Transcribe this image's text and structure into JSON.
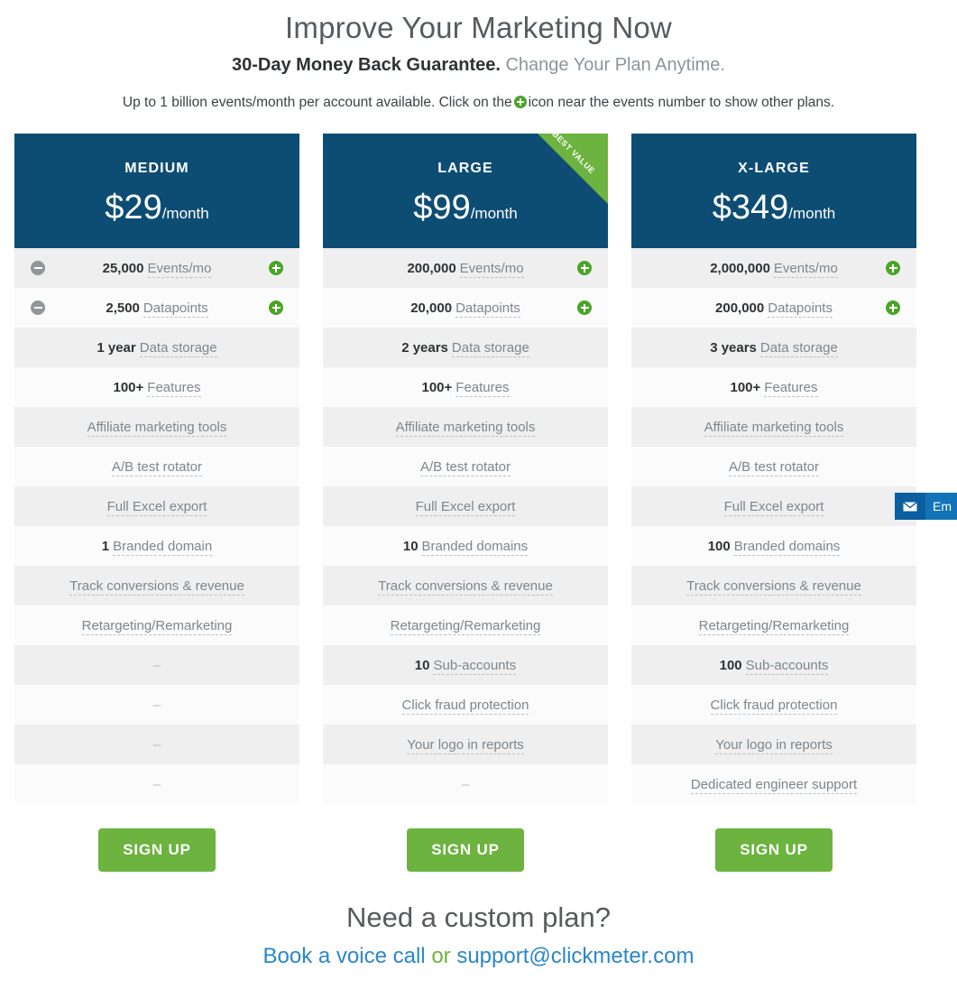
{
  "hero": {
    "title": "Improve Your Marketing Now",
    "subtitle_strong": "30-Day Money Back Guarantee.",
    "subtitle_muted": "Change Your Plan Anytime.",
    "note_before": "Up to 1 billion events/month per account available. Click on the",
    "note_after": "icon near the events number to show other plans.",
    "plus_icon": "plus-circle-icon"
  },
  "colors": {
    "header_navy": "#0d4d74",
    "accent_green": "#6cb33f",
    "icon_green": "#4aa527",
    "icon_gray": "#8f9799",
    "link_blue": "#2a87c8",
    "row_odd": "#efefef",
    "row_even": "#fbfbfb"
  },
  "plans": [
    {
      "name": "MEDIUM",
      "price": "$29",
      "per": "/month",
      "badge": null,
      "signup_label": "SIGN UP",
      "rows": [
        {
          "num": "25,000",
          "label": "Events/mo",
          "minus": true,
          "plus": true
        },
        {
          "num": "2,500",
          "label": "Datapoints",
          "minus": true,
          "plus": true
        },
        {
          "num": "1 year",
          "label": "Data storage",
          "minus": false,
          "plus": false
        },
        {
          "num": "100+",
          "label": "Features",
          "minus": false,
          "plus": false
        },
        {
          "num": "",
          "label": "Affiliate marketing tools",
          "minus": false,
          "plus": false
        },
        {
          "num": "",
          "label": "A/B test rotator",
          "minus": false,
          "plus": false
        },
        {
          "num": "",
          "label": "Full Excel export",
          "minus": false,
          "plus": false
        },
        {
          "num": "1",
          "label": "Branded domain",
          "minus": false,
          "plus": false
        },
        {
          "num": "",
          "label": "Track conversions & revenue",
          "minus": false,
          "plus": false
        },
        {
          "num": "",
          "label": "Retargeting/Remarketing",
          "minus": false,
          "plus": false
        },
        {
          "num": "",
          "label": "",
          "dash": "–",
          "minus": false,
          "plus": false
        },
        {
          "num": "",
          "label": "",
          "dash": "–",
          "minus": false,
          "plus": false
        },
        {
          "num": "",
          "label": "",
          "dash": "–",
          "minus": false,
          "plus": false
        },
        {
          "num": "",
          "label": "",
          "dash": "–",
          "minus": false,
          "plus": false
        }
      ]
    },
    {
      "name": "LARGE",
      "price": "$99",
      "per": "/month",
      "badge": "BEST VALUE",
      "signup_label": "SIGN UP",
      "rows": [
        {
          "num": "200,000",
          "label": "Events/mo",
          "minus": false,
          "plus": true
        },
        {
          "num": "20,000",
          "label": "Datapoints",
          "minus": false,
          "plus": true
        },
        {
          "num": "2 years",
          "label": "Data storage",
          "minus": false,
          "plus": false
        },
        {
          "num": "100+",
          "label": "Features",
          "minus": false,
          "plus": false
        },
        {
          "num": "",
          "label": "Affiliate marketing tools",
          "minus": false,
          "plus": false
        },
        {
          "num": "",
          "label": "A/B test rotator",
          "minus": false,
          "plus": false
        },
        {
          "num": "",
          "label": "Full Excel export",
          "minus": false,
          "plus": false
        },
        {
          "num": "10",
          "label": "Branded domains",
          "minus": false,
          "plus": false
        },
        {
          "num": "",
          "label": "Track conversions & revenue",
          "minus": false,
          "plus": false
        },
        {
          "num": "",
          "label": "Retargeting/Remarketing",
          "minus": false,
          "plus": false
        },
        {
          "num": "10",
          "label": "Sub-accounts",
          "minus": false,
          "plus": false
        },
        {
          "num": "",
          "label": "Click fraud protection",
          "minus": false,
          "plus": false
        },
        {
          "num": "",
          "label": "Your logo in reports",
          "minus": false,
          "plus": false
        },
        {
          "num": "",
          "label": "",
          "dash": "–",
          "minus": false,
          "plus": false
        }
      ]
    },
    {
      "name": "X-LARGE",
      "price": "$349",
      "per": "/month",
      "badge": null,
      "signup_label": "SIGN UP",
      "rows": [
        {
          "num": "2,000,000",
          "label": "Events/mo",
          "minus": false,
          "plus": true
        },
        {
          "num": "200,000",
          "label": "Datapoints",
          "minus": false,
          "plus": true
        },
        {
          "num": "3 years",
          "label": "Data storage",
          "minus": false,
          "plus": false
        },
        {
          "num": "100+",
          "label": "Features",
          "minus": false,
          "plus": false
        },
        {
          "num": "",
          "label": "Affiliate marketing tools",
          "minus": false,
          "plus": false
        },
        {
          "num": "",
          "label": "A/B test rotator",
          "minus": false,
          "plus": false
        },
        {
          "num": "",
          "label": "Full Excel export",
          "minus": false,
          "plus": false
        },
        {
          "num": "100",
          "label": "Branded domains",
          "minus": false,
          "plus": false
        },
        {
          "num": "",
          "label": "Track conversions & revenue",
          "minus": false,
          "plus": false
        },
        {
          "num": "",
          "label": "Retargeting/Remarketing",
          "minus": false,
          "plus": false
        },
        {
          "num": "100",
          "label": "Sub-accounts",
          "minus": false,
          "plus": false
        },
        {
          "num": "",
          "label": "Click fraud protection",
          "minus": false,
          "plus": false
        },
        {
          "num": "",
          "label": "Your logo in reports",
          "minus": false,
          "plus": false
        },
        {
          "num": "",
          "label": "Dedicated engineer support",
          "minus": false,
          "plus": false
        }
      ]
    }
  ],
  "footer": {
    "title": "Need a custom plan?",
    "link_call": "Book a voice call",
    "or": "or",
    "link_email": "support@clickmeter.com"
  },
  "email_widget": {
    "icon": "envelope-icon",
    "label": "Em"
  }
}
